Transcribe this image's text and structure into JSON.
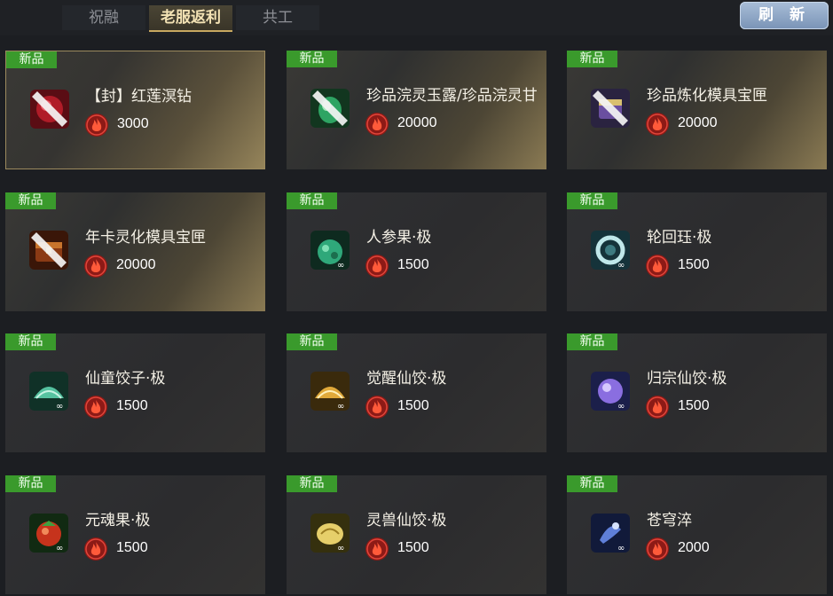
{
  "tabs": [
    {
      "label": "祝融",
      "active": false
    },
    {
      "label": "老服返利",
      "active": true
    },
    {
      "label": "共工",
      "active": false
    }
  ],
  "refresh_label": "刷 新",
  "items": [
    {
      "badge": "新品",
      "name": "【封】红莲溟钻",
      "currency_icon": "fire-coin-icon",
      "price": "3000",
      "icon": "sealed-red-gem-icon",
      "style": "gold",
      "selected": true
    },
    {
      "badge": "新品",
      "name": "珍品浣灵玉露/珍品浣灵甘",
      "currency_icon": "fire-coin-icon",
      "price": "20000",
      "icon": "sealed-jade-bottle-icon",
      "style": "gold",
      "selected": false
    },
    {
      "badge": "新品",
      "name": "珍品炼化模具宝匣",
      "currency_icon": "fire-coin-icon",
      "price": "20000",
      "icon": "sealed-mold-box-icon",
      "style": "gold",
      "selected": false
    },
    {
      "badge": "新品",
      "name": "年卡灵化模具宝匣",
      "currency_icon": "fire-coin-icon",
      "price": "20000",
      "icon": "sealed-chest-icon",
      "style": "gold",
      "selected": false
    },
    {
      "badge": "新品",
      "name": "人参果·极",
      "currency_icon": "fire-coin-icon",
      "price": "1500",
      "icon": "ginseng-fruit-icon",
      "style": "plain",
      "selected": false
    },
    {
      "badge": "新品",
      "name": "轮回珏·极",
      "currency_icon": "fire-coin-icon",
      "price": "1500",
      "icon": "jade-ring-icon",
      "style": "plain",
      "selected": false
    },
    {
      "badge": "新品",
      "name": "仙童饺子·极",
      "currency_icon": "fire-coin-icon",
      "price": "1500",
      "icon": "green-dumpling-icon",
      "style": "plain",
      "selected": false
    },
    {
      "badge": "新品",
      "name": "觉醒仙饺·极",
      "currency_icon": "fire-coin-icon",
      "price": "1500",
      "icon": "golden-dumpling-icon",
      "style": "plain",
      "selected": false
    },
    {
      "badge": "新品",
      "name": "归宗仙饺·极",
      "currency_icon": "fire-coin-icon",
      "price": "1500",
      "icon": "purple-dumpling-icon",
      "style": "plain",
      "selected": false
    },
    {
      "badge": "新品",
      "name": "元魂果·极",
      "currency_icon": "fire-coin-icon",
      "price": "1500",
      "icon": "red-soul-fruit-icon",
      "style": "plain",
      "selected": false
    },
    {
      "badge": "新品",
      "name": "灵兽仙饺·极",
      "currency_icon": "fire-coin-icon",
      "price": "1500",
      "icon": "beast-dumpling-icon",
      "style": "plain",
      "selected": false
    },
    {
      "badge": "新品",
      "name": "苍穹淬",
      "currency_icon": "fire-coin-icon",
      "price": "2000",
      "icon": "sky-temper-icon",
      "style": "plain",
      "selected": false
    }
  ],
  "colors": {
    "badge": "#3a9a2c",
    "refresh_button": "#8fa8c8",
    "active_tab_text": "#f3e2b4",
    "coin": "#b8241c"
  }
}
